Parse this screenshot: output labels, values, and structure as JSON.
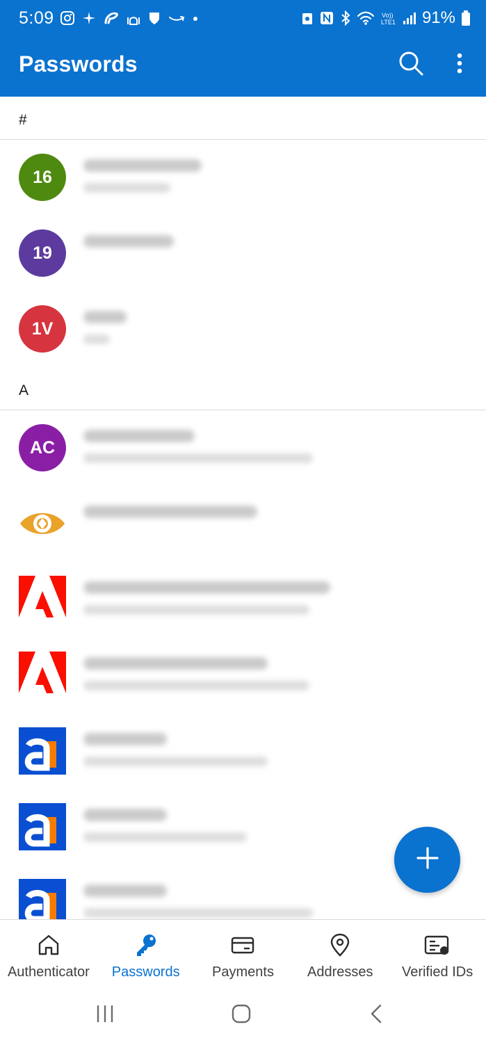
{
  "status_bar": {
    "time": "5:09",
    "battery": "91%"
  },
  "app_bar": {
    "title": "Passwords"
  },
  "colors": {
    "accent": "#0a72cf",
    "avatar_16": "#4f8a10",
    "avatar_19": "#5c3a9e",
    "avatar_1v": "#d6343f",
    "avatar_ac": "#8a1fa5"
  },
  "sections": [
    {
      "letter": "#"
    },
    {
      "letter": "A"
    }
  ],
  "entries": [
    {
      "avatar_text": "16",
      "icon": "avatar-initials"
    },
    {
      "avatar_text": "19",
      "icon": "avatar-initials"
    },
    {
      "avatar_text": "1V",
      "icon": "avatar-initials"
    },
    {
      "avatar_text": "AC",
      "icon": "avatar-initials"
    },
    {
      "icon": "eye-shutter-logo-icon"
    },
    {
      "icon": "adobe-logo-icon"
    },
    {
      "icon": "adobe-logo-icon"
    },
    {
      "icon": "a-logo-icon"
    },
    {
      "icon": "a-logo-icon"
    },
    {
      "icon": "a-logo-icon"
    }
  ],
  "fab": {
    "icon": "plus-icon"
  },
  "bottom_nav": {
    "items": [
      {
        "label": "Authenticator",
        "icon": "home-icon",
        "active": false
      },
      {
        "label": "Passwords",
        "icon": "key-icon",
        "active": true
      },
      {
        "label": "Payments",
        "icon": "card-icon",
        "active": false
      },
      {
        "label": "Addresses",
        "icon": "location-pin-icon",
        "active": false
      },
      {
        "label": "Verified IDs",
        "icon": "id-card-icon",
        "active": false
      }
    ]
  },
  "system_nav": {
    "buttons": [
      "recents-icon",
      "home-circle-icon",
      "back-icon"
    ]
  }
}
